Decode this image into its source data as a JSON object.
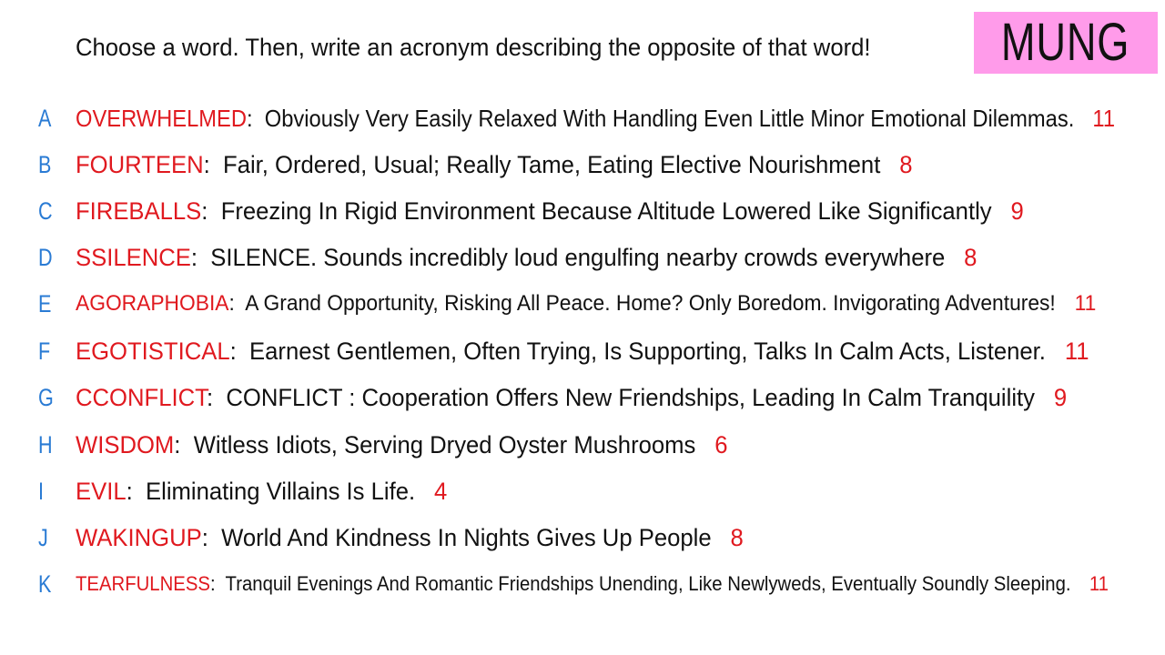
{
  "prompt": "Choose a word. Then, write an acronym describing the opposite of that word!",
  "badge": {
    "text": "MUNG"
  },
  "colors": {
    "letter": "#2a7bd4",
    "word": "#e0191f",
    "count": "#e0191f",
    "text": "#111111",
    "badge_bg": "#ff9bea"
  },
  "rows": [
    {
      "letter": "A",
      "word": "OVERWHELMED",
      "separator": ":",
      "acronym": "Obviously Very Easily Relaxed With Handling Even Little Minor Emotional Dilemmas.",
      "count": "11"
    },
    {
      "letter": "B",
      "word": "FOURTEEN",
      "separator": ":",
      "acronym": "Fair, Ordered, Usual; Really Tame, Eating Elective Nourishment",
      "count": "8"
    },
    {
      "letter": "C",
      "word": "FIREBALLS",
      "separator": ":",
      "acronym": "Freezing In Rigid Environment Because Altitude Lowered Like Significantly",
      "count": "9"
    },
    {
      "letter": "D",
      "word": "SSILENCE",
      "separator": ":",
      "acronym": "SILENCE. Sounds incredibly loud engulfing nearby crowds everywhere",
      "count": "8"
    },
    {
      "letter": "E",
      "word": "AGORAPHOBIA",
      "separator": ":",
      "acronym": "A Grand Opportunity, Risking All Peace. Home? Only Boredom. Invigorating Adventures!",
      "count": "11"
    },
    {
      "letter": "F",
      "word": "EGOTISTICAL",
      "separator": ":",
      "acronym": "Earnest Gentlemen, Often Trying, Is Supporting, Talks In Calm Acts, Listener.",
      "count": "11"
    },
    {
      "letter": "G",
      "word": "CCONFLICT",
      "separator": ":",
      "acronym": "CONFLICT : Cooperation Offers New Friendships, Leading In Calm Tranquility",
      "count": "9"
    },
    {
      "letter": "H",
      "word": "WISDOM",
      "separator": ":",
      "acronym": "Witless Idiots, Serving Dryed Oyster Mushrooms",
      "count": "6"
    },
    {
      "letter": "I",
      "word": "EVIL",
      "separator": ":",
      "acronym": "Eliminating Villains Is Life.",
      "count": "4"
    },
    {
      "letter": "J",
      "word": "WAKINGUP",
      "separator": ":",
      "acronym": "World And Kindness In Nights Gives Up People",
      "count": "8"
    },
    {
      "letter": "K",
      "word": "TEARFULNESS",
      "separator": ":",
      "acronym": "Tranquil Evenings And Romantic Friendships Unending, Like Newlyweds, Eventually Soundly Sleeping.",
      "count": "11"
    }
  ]
}
